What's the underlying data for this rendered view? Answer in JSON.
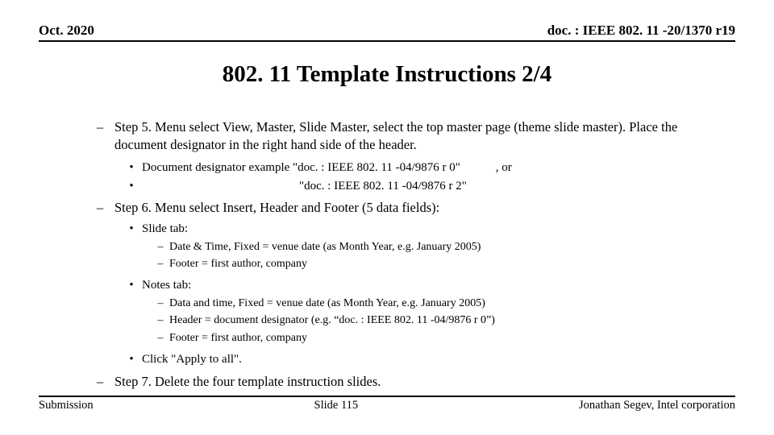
{
  "header": {
    "left": "Oct. 2020",
    "right": "doc. : IEEE 802. 11 -20/1370 r19"
  },
  "title": "802. 11 Template Instructions 2/4",
  "step5": {
    "text": "Step 5. Menu select View, Master, Slide Master, select the top master page (theme slide master).  Place the document designator in the right hand side of the header.",
    "sub1_prefix": "Document designator example \"doc. : IEEE 802. 11 -04/9876 r 0\"",
    "sub1_suffix": ", or",
    "sub2": "                                                    \"doc. : IEEE 802. 11 -04/9876 r 2\""
  },
  "step6": {
    "text": "Step 6. Menu select Insert, Header and Footer (5 data fields):",
    "slide_tab": "Slide tab:",
    "slide_sub1": "Date & Time, Fixed =  venue date (as Month Year, e.g. January 2005)",
    "slide_sub2": "Footer = first author, company",
    "notes_tab": "Notes tab:",
    "notes_sub1": "Data and time, Fixed = venue date (as Month Year, e.g. January 2005)",
    "notes_sub2": "Header = document designator (e.g. “doc. : IEEE 802. 11 -04/9876 r 0”)",
    "notes_sub3": "Footer = first author, company",
    "apply": "Click \"Apply to all\"."
  },
  "step7": {
    "text": "Step 7. Delete the four template instruction slides."
  },
  "footer": {
    "left": "Submission",
    "center": "Slide 115",
    "right": "Jonathan Segev, Intel corporation"
  }
}
